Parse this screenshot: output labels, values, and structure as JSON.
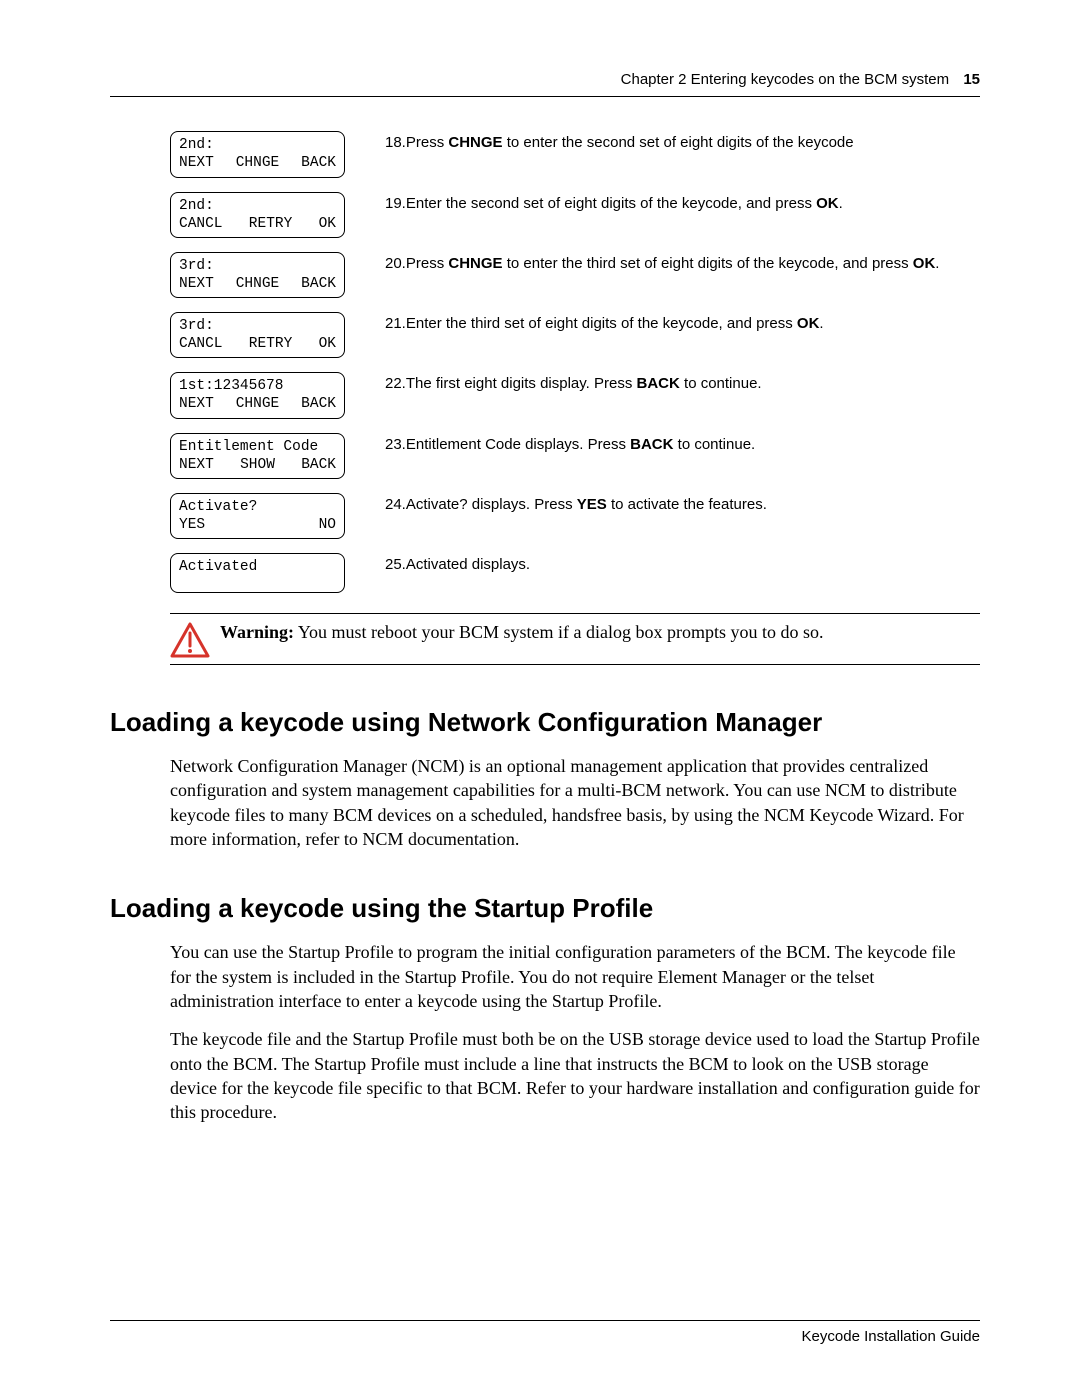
{
  "header": {
    "chapter": "Chapter 2  Entering keycodes on the BCM system",
    "page_num": "15"
  },
  "rows": [
    {
      "display": {
        "top": "2nd:",
        "sk1": "NEXT",
        "sk2": "CHNGE",
        "sk3": "BACK"
      },
      "inst_num": "18.",
      "inst_html": "Press <b>CHNGE</b> to enter the second set of eight digits of the keycode"
    },
    {
      "display": {
        "top": "2nd:",
        "sk1": "CANCL",
        "sk2": "RETRY",
        "sk3": "OK"
      },
      "inst_num": "19.",
      "inst_html": "Enter the second set of eight digits of the keycode, and press <b>OK</b>."
    },
    {
      "display": {
        "top": "3rd:",
        "sk1": "NEXT",
        "sk2": "CHNGE",
        "sk3": "BACK"
      },
      "inst_num": "20.",
      "inst_html": "Press <b>CHNGE</b> to enter the third set of eight digits of the keycode, and press <b>OK</b>."
    },
    {
      "display": {
        "top": "3rd:",
        "sk1": "CANCL",
        "sk2": "RETRY",
        "sk3": "OK"
      },
      "inst_num": "21.",
      "inst_html": "Enter the third set of eight digits of the keycode, and press <b>OK</b>."
    },
    {
      "display": {
        "top": "1st:12345678",
        "sk1": "NEXT",
        "sk2": "CHNGE",
        "sk3": "BACK"
      },
      "inst_num": "22.",
      "inst_html": "The first eight digits display. Press <b>BACK</b> to continue."
    },
    {
      "display": {
        "top": "Entitlement Code",
        "sk1": "NEXT",
        "sk2": "SHOW",
        "sk3": "BACK"
      },
      "inst_num": "23.",
      "inst_html": "Entitlement Code displays. Press <b>BACK</b> to continue."
    },
    {
      "display": {
        "top": "Activate?",
        "sk1": "YES",
        "sk2": "",
        "sk3": "NO"
      },
      "inst_num": "24.",
      "inst_html": "Activate? displays. Press <b>YES</b> to activate the features."
    },
    {
      "display": {
        "top": "Activated",
        "sk1": "",
        "sk2": "",
        "sk3": ""
      },
      "inst_num": "25.",
      "inst_html": "Activated displays."
    }
  ],
  "warning_label": "Warning:",
  "warning_text": " You must reboot your BCM system if a dialog box prompts you to do so.",
  "section1": {
    "heading": "Loading a keycode using Network Configuration Manager",
    "para": "Network Configuration Manager (NCM) is an optional management application that provides centralized configuration and system management capabilities for a multi-BCM network. You can use NCM to distribute keycode files to many BCM devices on a scheduled, handsfree basis, by using the NCM Keycode Wizard. For more information, refer to NCM documentation."
  },
  "section2": {
    "heading": "Loading a keycode using the Startup Profile",
    "para1": "You can use the Startup Profile to program the initial configuration parameters of the BCM. The keycode file for the system is included in the Startup Profile. You do not require Element Manager or the telset administration interface to enter a keycode using the Startup Profile.",
    "para2": "The keycode file and the Startup Profile must both be on the USB storage device used to load the Startup Profile onto the BCM. The Startup Profile must include a line that instructs the BCM to look on the USB storage device for the keycode file specific to that BCM. Refer to your hardware installation and configuration guide for this procedure."
  },
  "footer": "Keycode Installation Guide"
}
